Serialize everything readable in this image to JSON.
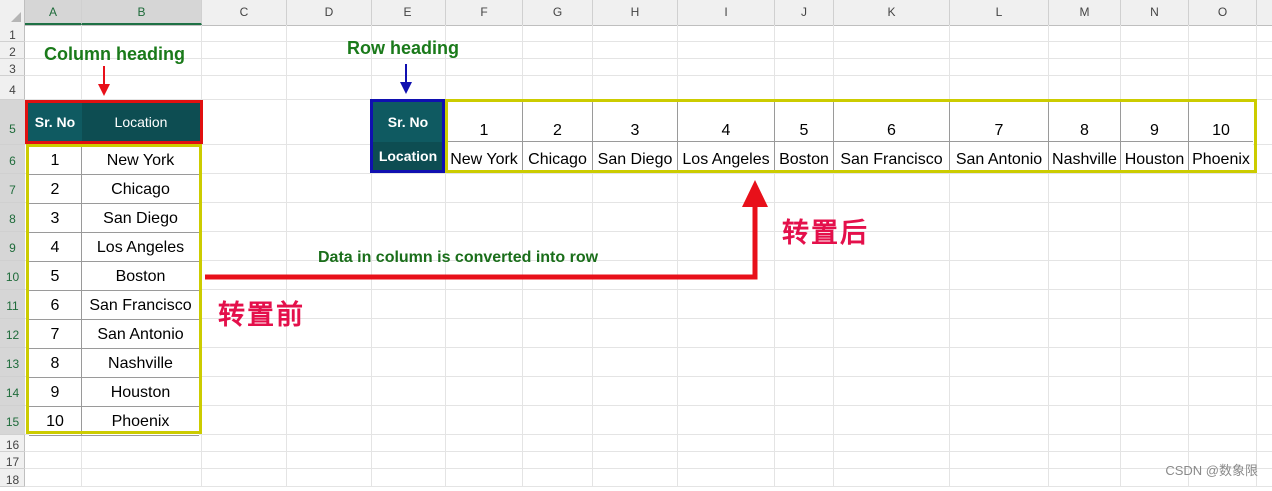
{
  "sheet": {
    "columns": [
      "A",
      "B",
      "C",
      "D",
      "E",
      "F",
      "G",
      "H",
      "I",
      "J",
      "K",
      "L",
      "M",
      "N",
      "O"
    ],
    "rows": [
      "1",
      "2",
      "3",
      "4",
      "5",
      "6",
      "7",
      "8",
      "9",
      "10",
      "11",
      "12",
      "13",
      "14",
      "15",
      "16",
      "17",
      "18"
    ]
  },
  "vertical_table": {
    "headers": [
      "Sr. No",
      "Location"
    ],
    "rows": [
      [
        "1",
        "New York"
      ],
      [
        "2",
        "Chicago"
      ],
      [
        "3",
        "San Diego"
      ],
      [
        "4",
        "Los Angeles"
      ],
      [
        "5",
        "Boston"
      ],
      [
        "6",
        "San Francisco"
      ],
      [
        "7",
        "San Antonio"
      ],
      [
        "8",
        "Nashville"
      ],
      [
        "9",
        "Houston"
      ],
      [
        "10",
        "Phoenix"
      ]
    ]
  },
  "horizontal_table": {
    "headers": [
      "Sr. No",
      "Location"
    ],
    "numbers": [
      "1",
      "2",
      "3",
      "4",
      "5",
      "6",
      "7",
      "8",
      "9",
      "10"
    ],
    "locations": [
      "New York",
      "Chicago",
      "San Diego",
      "Los Angeles",
      "Boston",
      "San Francisco",
      "San Antonio",
      "Nashville",
      "Houston",
      "Phoenix"
    ]
  },
  "annotations": {
    "column_heading": "Column heading",
    "row_heading": "Row heading",
    "flow_text": "Data in column is converted into row",
    "before": "转置前",
    "after": "转置后",
    "watermark": "CSDN @数象限"
  },
  "colors": {
    "header_teal": "#0f5a61",
    "box_red": "#e01010",
    "box_yellow": "#cccc00",
    "box_blue": "#1010b0",
    "label_green": "#1a7a1a",
    "arrow_red": "#e8101a",
    "arrow_blue": "#1010b0",
    "cn_text": "#e4104b"
  }
}
